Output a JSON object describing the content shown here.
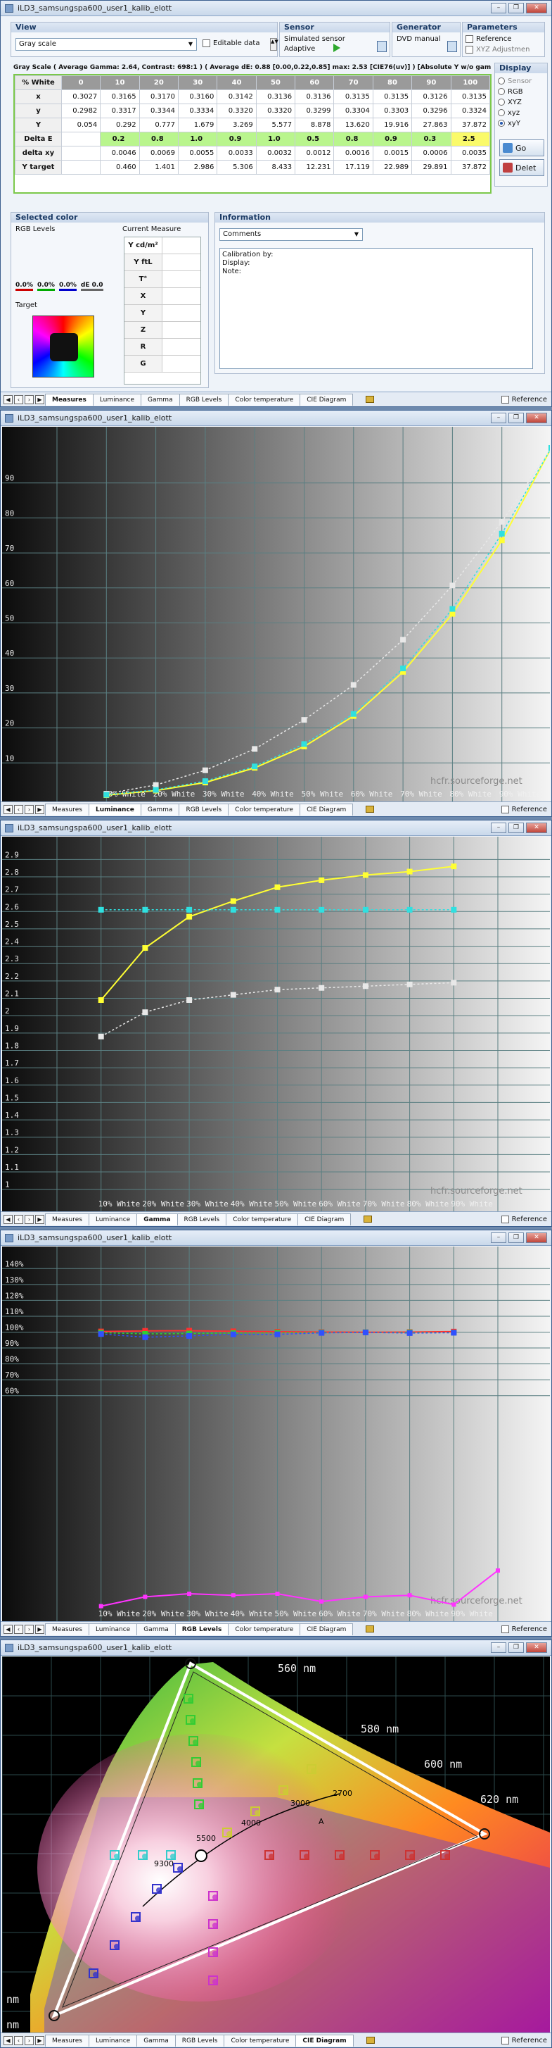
{
  "windows": {
    "measures": {
      "title": "iLD3_samsungspa600_user1_kalib_elott"
    },
    "luminance": {
      "title": "iLD3_samsungspa600_user1_kalib_elott"
    },
    "gamma": {
      "title": "iLD3_samsungspa600_user1_kalib_elott"
    },
    "rgb": {
      "title": "iLD3_samsungspa600_user1_kalib_elott"
    },
    "cie": {
      "title": "iLD3_samsungspa600_user1_kalib_elott"
    }
  },
  "tabs": [
    "Measures",
    "Luminance",
    "Gamma",
    "RGB Levels",
    "Color temperature",
    "CIE Diagram"
  ],
  "reference_label": "Reference",
  "view": {
    "group_title": "View",
    "select_value": "Gray scale",
    "editable_label": "Editable data"
  },
  "sensor": {
    "group_title": "Sensor",
    "line1": "Simulated sensor",
    "line2": "Adaptive"
  },
  "generator": {
    "group_title": "Generator",
    "line1": "DVD manual"
  },
  "parameters": {
    "group_title": "Parameters",
    "reference": "Reference",
    "xyz_adjust": "XYZ Adjustmen"
  },
  "summary": "Gray Scale ( Average Gamma: 2.64, Contrast: 698:1 ) ( Average dE: 0.88 [0.00,0.22,0.85]  max: 2.53 [CIE76(uv)] ) [Absolute Y w/o gamma",
  "measures_table": {
    "headers": [
      "% White",
      "0",
      "10",
      "20",
      "30",
      "40",
      "50",
      "60",
      "70",
      "80",
      "90",
      "100"
    ],
    "rows": [
      {
        "label": "x",
        "values": [
          "0.3027",
          "0.3165",
          "0.3170",
          "0.3160",
          "0.3142",
          "0.3136",
          "0.3136",
          "0.3135",
          "0.3135",
          "0.3126",
          "0.3135"
        ]
      },
      {
        "label": "y",
        "values": [
          "0.2982",
          "0.3317",
          "0.3344",
          "0.3334",
          "0.3320",
          "0.3320",
          "0.3299",
          "0.3304",
          "0.3303",
          "0.3296",
          "0.3324"
        ]
      },
      {
        "label": "Y",
        "values": [
          "0.054",
          "0.292",
          "0.777",
          "1.679",
          "3.269",
          "5.577",
          "8.878",
          "13.620",
          "19.916",
          "27.863",
          "37.872"
        ]
      },
      {
        "label": "Delta E",
        "values": [
          "",
          "0.2",
          "0.8",
          "1.0",
          "0.9",
          "1.0",
          "0.5",
          "0.8",
          "0.9",
          "0.3",
          "2.5"
        ]
      },
      {
        "label": "delta xy",
        "values": [
          "",
          "0.0046",
          "0.0069",
          "0.0055",
          "0.0033",
          "0.0032",
          "0.0012",
          "0.0016",
          "0.0015",
          "0.0006",
          "0.0035"
        ]
      },
      {
        "label": "Y target",
        "values": [
          "",
          "0.460",
          "1.401",
          "2.986",
          "5.306",
          "8.433",
          "12.231",
          "17.119",
          "22.989",
          "29.891",
          "37.872"
        ]
      }
    ]
  },
  "display": {
    "group_title": "Display",
    "options": [
      "Sensor",
      "RGB",
      "XYZ",
      "xyz",
      "xyY"
    ],
    "selected": "xyY",
    "go": "Go",
    "delete": "Delet"
  },
  "selected_color": {
    "group_title": "Selected color",
    "rgb_levels": "RGB Levels",
    "current_measure": "Current Measure",
    "target": "Target",
    "level_values": [
      "0.0%",
      "0.0%",
      "0.0%",
      "dE 0.0"
    ],
    "measure_rows": [
      "Y cd/m²",
      "Y ftL",
      "T°",
      "X",
      "Y",
      "Z",
      "R",
      "G"
    ]
  },
  "information": {
    "group_title": "Information",
    "select_value": "Comments",
    "lines": [
      "Calibration by:",
      "Display:",
      "Note:"
    ]
  },
  "watermark": "hcfr.sourceforge.net",
  "luminance_chart": {
    "chart_data": {
      "type": "line",
      "x": [
        10,
        20,
        30,
        40,
        50,
        60,
        70,
        80,
        90,
        100
      ],
      "x_tick_labels": [
        "10% White",
        "20% White",
        "30% White",
        "40% White",
        "50% White",
        "60% White",
        "70% White",
        "80% White",
        "90% White"
      ],
      "y_ticks": [
        "90",
        "80",
        "70",
        "60",
        "50",
        "40",
        "30",
        "20",
        "10"
      ],
      "ylim": [
        0,
        100
      ],
      "series": [
        {
          "values": [
            0.8,
            2.1,
            4.4,
            8.6,
            14.7,
            23.4,
            36.0,
            52.6,
            73.6,
            100
          ],
          "color": "#ffff33"
        },
        {
          "values": [
            1.2,
            3.7,
            7.9,
            14.0,
            22.3,
            32.3,
            45.2,
            60.7,
            78.9,
            100
          ],
          "color": "#e8e8e8"
        },
        {
          "values": [
            0.9,
            2.3,
            4.8,
            9.0,
            15.4,
            24.0,
            37.0,
            54.0,
            75.5,
            100
          ],
          "color": "#2fe0e0"
        }
      ]
    }
  },
  "gamma_chart": {
    "chart_data": {
      "type": "line",
      "x": [
        10,
        20,
        30,
        40,
        50,
        60,
        70,
        80,
        90
      ],
      "x_tick_labels": [
        "10% White",
        "20% White",
        "30% White",
        "40% White",
        "50% White",
        "60% White",
        "70% White",
        "80% White",
        "90% White"
      ],
      "y_ticks": [
        "2.9",
        "2.8",
        "2.7",
        "2.6",
        "2.5",
        "2.4",
        "2.3",
        "2.2",
        "2.1",
        "2",
        "1.9",
        "1.8",
        "1.7",
        "1.6",
        "1.5",
        "1.4",
        "1.3",
        "1.2",
        "1.1",
        "1"
      ],
      "ylim": [
        0.95,
        2.95
      ],
      "series": [
        {
          "values": [
            2.09,
            2.39,
            2.57,
            2.66,
            2.74,
            2.78,
            2.81,
            2.83,
            2.86
          ],
          "color": "#ffff33"
        },
        {
          "values": [
            1.88,
            2.02,
            2.09,
            2.12,
            2.15,
            2.16,
            2.17,
            2.18,
            2.19
          ],
          "color": "#e8e8e8"
        },
        {
          "values": [
            2.61,
            2.61,
            2.61,
            2.61,
            2.61,
            2.61,
            2.61,
            2.61,
            2.61
          ],
          "color": "#2fe0e0"
        }
      ]
    }
  },
  "rgb_chart": {
    "chart_data": {
      "type": "line",
      "x": [
        10,
        20,
        30,
        40,
        50,
        60,
        70,
        80,
        90
      ],
      "x_tick_labels": [
        "10% White",
        "20% White",
        "30% White",
        "40% White",
        "50% White",
        "60% White",
        "70% White",
        "80% White",
        "90% White"
      ],
      "y_ticks": [
        "140%",
        "130%",
        "120%",
        "110%",
        "100%",
        "90%",
        "80%",
        "70%",
        "60%"
      ],
      "ylim": [
        55,
        145
      ],
      "series": [
        {
          "name": "R",
          "values": [
            100.4,
            100.8,
            100.9,
            100.5,
            100.2,
            100.0,
            99.9,
            100.0,
            100.3
          ],
          "color": "#ff3030"
        },
        {
          "name": "G",
          "values": [
            99.6,
            98.9,
            99.1,
            99.4,
            99.6,
            99.8,
            99.9,
            99.8,
            99.7
          ],
          "color": "#30d030"
        },
        {
          "name": "B",
          "values": [
            98.8,
            96.8,
            97.6,
            98.6,
            98.6,
            99.5,
            99.8,
            99.4,
            99.6
          ],
          "color": "#3050ff"
        }
      ],
      "magenta_series_values": [
        0.2,
        0.8,
        1.0,
        0.9,
        1.0,
        0.5,
        0.8,
        0.9,
        0.3,
        2.5
      ]
    }
  },
  "cie_chart": {
    "wavelength_labels": [
      "560 nm",
      "580 nm",
      "600 nm",
      "620 nm",
      "nm",
      "nm"
    ],
    "temp_labels": [
      "2700",
      "3000",
      "4000",
      "5500",
      "9300",
      "A"
    ],
    "chart_data": {
      "type": "scatter",
      "gamut_triangle": [
        [
          0.64,
          0.33
        ],
        [
          0.3,
          0.6
        ],
        [
          0.15,
          0.06
        ]
      ],
      "white_point": [
        0.3127,
        0.329
      ]
    }
  }
}
